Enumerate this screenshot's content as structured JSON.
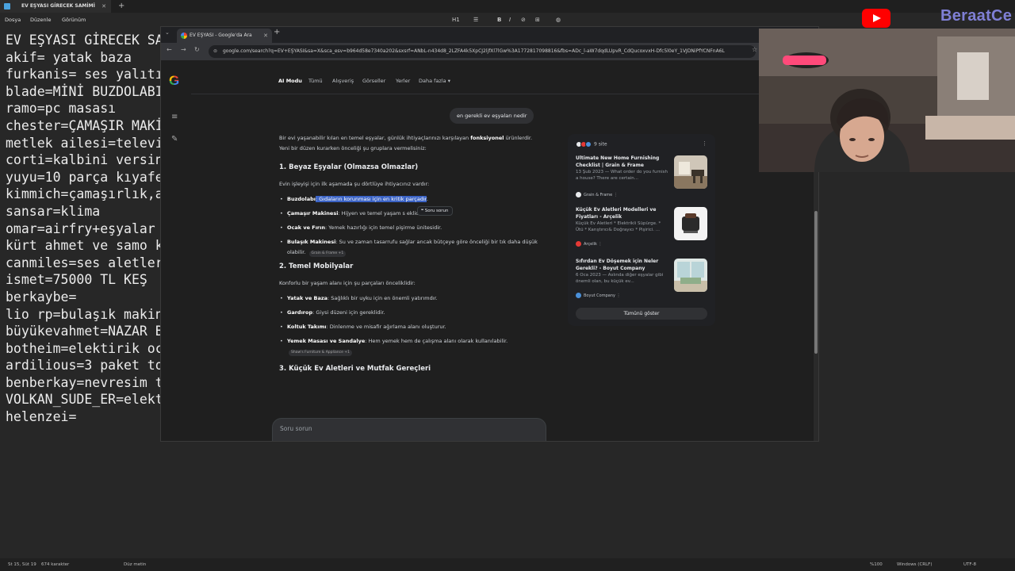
{
  "notepad": {
    "tab_title": "EV EŞYASI GİRECEK SAMİMİ DOSTLİ",
    "menu": [
      "Dosya",
      "Düzenle",
      "Görünüm"
    ],
    "toolbar": [
      "H1",
      "☰",
      "B",
      "I",
      "⊘",
      "⊞",
      "◍"
    ],
    "lines": [
      "EV EŞYASI GİRECEK SA",
      "akif= yatak baza",
      "furkanis= ses yalıtı",
      "blade=MİNİ BUZDOLABI",
      "ramo=pc masası",
      "chester=ÇAMAŞIR MAKİ",
      "metlek ailesi=televi",
      "corti=kalbini versin",
      "yuyu=10 parça kıyafe",
      "kimmich=çamaşırlık,a",
      "sansar=klima",
      "omar=airfry+eşyalar",
      "kürt ahmet ve samo k",
      "canmiles=ses aletler",
      "ismet=75000 TL KEŞ",
      "berkaybe=",
      "lio rp=bulaşık makin",
      "büyükevahmet=NAZAR B",
      "botheim=elektirik oc",
      "ardilious=3 paket to",
      "benberkay=nevresim t",
      "VOLKAN_SUDE_ER=elekt",
      "helenzei="
    ],
    "status": {
      "position": "St 15, Süt 19",
      "chars": "674 karakter",
      "mode": "Düz metin",
      "zoom": "%100",
      "eol": "Windows (CRLF)",
      "encoding": "UTF-8"
    }
  },
  "browser": {
    "tab_title": "EV EŞYASI - Google'da Ara",
    "url": "google.com/search?q=EV+EŞYASI&sa=X&sca_esv=b964d58e7340a202&sxsrf=ANbL-n434d8_2LZFA4k5XpCJ2ljfXl7lGw%3A1772817098816&fbs=ADc_l-aW7dqdLUpvR_CdQucoxvxH-Dfc5l0eY_1VJDNiPfYCNFnA6L"
  },
  "google": {
    "nav": [
      "AI Modu",
      "Tümü",
      "Alışveriş",
      "Görseller",
      "Yerler",
      "Daha fazla ▾"
    ],
    "user_query": "en gerekli ev eşyaları nedir",
    "intro_pre": "Bir evi yaşanabilir kılan en temel eşyalar, günlük ihtiyaçlarınızı karşılayan ",
    "intro_bold": "fonksiyonel",
    "intro_post": " ürünlerdir. Yeni bir düzen kurarken önceliği şu gruplara vermelisiniz:",
    "s1_title": "1. Beyaz Eşyalar (Olmazsa Olmazlar)",
    "s1_intro": "Evin işleyişi için ilk aşamada şu dörtlüye ihtiyacınız vardır:",
    "s1_items": [
      {
        "b": "Buzdolabı",
        "pre": "",
        "hl": ": Gıdaların korunması için en kritik parçadır",
        "t": "."
      },
      {
        "b": "Çamaşır Makinesi",
        "pre": "",
        "hl": "",
        "t": ": Hijyen ve temel yaşam s          eklidir."
      },
      {
        "b": "Ocak ve Fırın",
        "pre": "",
        "hl": "",
        "t": ": Yemek hazırlığı için temel pişirme ünitesidir."
      },
      {
        "b": "Bulaşık Makinesi",
        "pre": "",
        "hl": "",
        "t": ": Su ve zaman tasarrufu sağlar ancak bütçeye göre önceliği bir tık daha düşük olabilir."
      }
    ],
    "s1_chip": "Grain & Frame +1",
    "s2_title": "2. Temel Mobilyalar",
    "s2_intro": "Konforlu bir yaşam alanı için şu parçaları önceliklidir:",
    "s2_items": [
      {
        "b": "Yatak ve Baza",
        "t": ": Sağlıklı bir uyku için en önemli yatırımdır."
      },
      {
        "b": "Gardırop",
        "t": ": Giysi düzeni için gereklidir."
      },
      {
        "b": "Koltuk Takımı",
        "t": ": Dinlenme ve misafir ağırlama alanı oluşturur."
      },
      {
        "b": "Yemek Masası ve Sandalye",
        "t": ": Hem yemek hem de çalışma alanı olarak kullanılabilir."
      }
    ],
    "s2_chip": "Shaw's Furniture & Appliance +1",
    "s3_title": "3. Küçük Ev Aletleri ve Mutfak Gereçleri",
    "tooltip": "❝ Soru sorun",
    "ask_placeholder": "Soru sorun",
    "ask_plus": "+",
    "ask_mic": "🎤",
    "sources_count": "9 site",
    "sources_more": "⋮",
    "sources": [
      {
        "title": "Ultimate New Home Furnishing Checklist | Grain & Frame",
        "snippet": "13 Şub 2023 — What order do you furnish a house? There are certain...",
        "site": "Grain & Frame",
        "color": "#e8eaed"
      },
      {
        "title": "Küçük Ev Aletleri Modelleri ve Fiyatları - Arçelik",
        "snippet": "Küçük Ev Aletleri * Elektrikli Süpürge. * Ütü * Karıştırıcı& Doğrayıcı * Pişirici. ...",
        "site": "Arçelik",
        "color": "#e53935"
      },
      {
        "title": "Sıfırdan Ev Döşemek için Neler Gerekli? - Boyut Company",
        "snippet": "6 Oca 2023 — Aslında diğer eşyalar gibi önemli olan, bu küçük ev...",
        "site": "Boyut Company",
        "color": "#4a90d9"
      }
    ],
    "show_all": "Tümünü göster"
  },
  "overlay": {
    "channel_name": "BeraatCe"
  }
}
